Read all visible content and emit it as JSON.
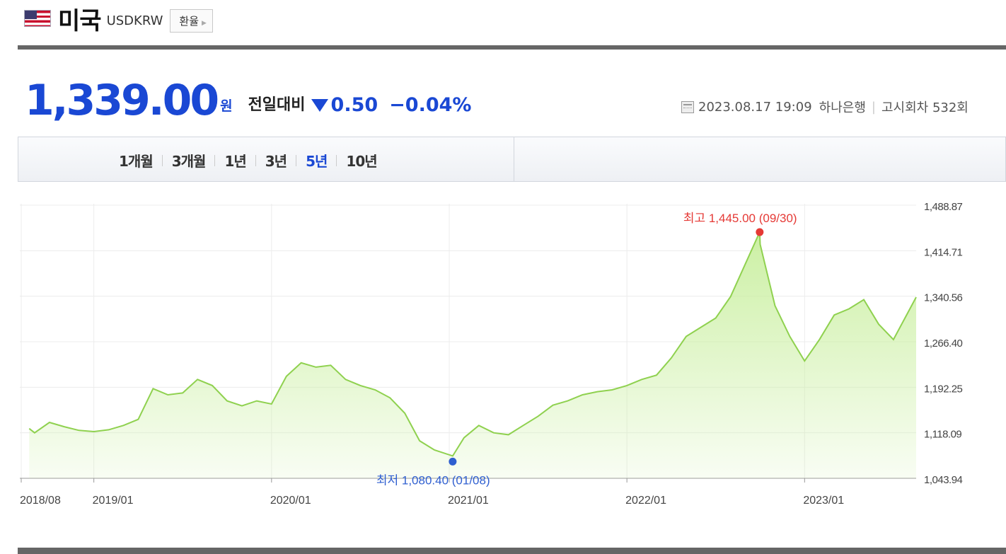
{
  "header": {
    "country": "미국",
    "code": "USDKRW",
    "fx_button": "환율",
    "flag_icon": "us-flag-icon"
  },
  "price": {
    "value": "1,339.00",
    "unit": "원",
    "compare_label": "전일대비",
    "direction": "down",
    "change": "0.50",
    "change_pct": "−0.04%"
  },
  "meta": {
    "datetime": "2023.08.17 19:09",
    "bank": "하나은행",
    "round": "고시회차 532회"
  },
  "tabs": [
    "1개월",
    "3개월",
    "1년",
    "3년",
    "5년",
    "10년"
  ],
  "active_tab": "5년",
  "colors": {
    "accent": "#1a48d4",
    "high": "#e53935",
    "low": "#2f5fd0",
    "line": "#8fd14f",
    "fill": "#c9ef9f"
  },
  "chart_data": {
    "type": "area",
    "x_labels": [
      "2018/08",
      "2019/01",
      "2020/01",
      "2021/01",
      "2022/01",
      "2023/01"
    ],
    "y_ticks": [
      "1,488.87",
      "1,414.71",
      "1,340.56",
      "1,266.40",
      "1,192.25",
      "1,118.09",
      "1,043.94"
    ],
    "ylim": [
      1043.94,
      1488.87
    ],
    "high_label": "최고 1,445.00 (09/30)",
    "low_label": "최저 1,080.40 (01/08)",
    "high": {
      "date": "2022/09/30",
      "value": 1445.0
    },
    "low": {
      "date": "2021/01/08",
      "value": 1080.4
    },
    "series": [
      {
        "x": [
          "2018/08/20",
          "2018/09",
          "2018/10",
          "2018/11",
          "2018/12",
          "2019/01",
          "2019/02",
          "2019/03",
          "2019/04",
          "2019/05",
          "2019/06",
          "2019/07",
          "2019/08",
          "2019/09",
          "2019/10",
          "2019/11",
          "2019/12",
          "2020/01",
          "2020/02",
          "2020/03",
          "2020/04",
          "2020/05",
          "2020/06",
          "2020/07",
          "2020/08",
          "2020/09",
          "2020/10",
          "2020/11",
          "2020/12",
          "2021/01/08",
          "2021/02",
          "2021/03",
          "2021/04",
          "2021/05",
          "2021/06",
          "2021/07",
          "2021/08",
          "2021/09",
          "2021/10",
          "2021/11",
          "2021/12",
          "2022/01",
          "2022/02",
          "2022/03",
          "2022/04",
          "2022/05",
          "2022/06",
          "2022/07",
          "2022/08",
          "2022/09/30",
          "2022/10",
          "2022/11",
          "2022/12",
          "2023/01",
          "2023/02",
          "2023/03",
          "2023/04",
          "2023/05",
          "2023/06",
          "2023/07",
          "2023/08/17"
        ],
        "values": [
          1125,
          1118,
          1135,
          1128,
          1122,
          1120,
          1123,
          1130,
          1140,
          1190,
          1180,
          1183,
          1205,
          1195,
          1170,
          1162,
          1170,
          1165,
          1210,
          1232,
          1225,
          1228,
          1205,
          1195,
          1188,
          1175,
          1150,
          1105,
          1090,
          1080.4,
          1110,
          1130,
          1118,
          1115,
          1130,
          1145,
          1163,
          1170,
          1180,
          1185,
          1188,
          1195,
          1205,
          1212,
          1240,
          1275,
          1290,
          1305,
          1340,
          1445,
          1425,
          1325,
          1275,
          1235,
          1270,
          1310,
          1320,
          1335,
          1295,
          1270,
          1339
        ]
      }
    ],
    "grid": true
  }
}
